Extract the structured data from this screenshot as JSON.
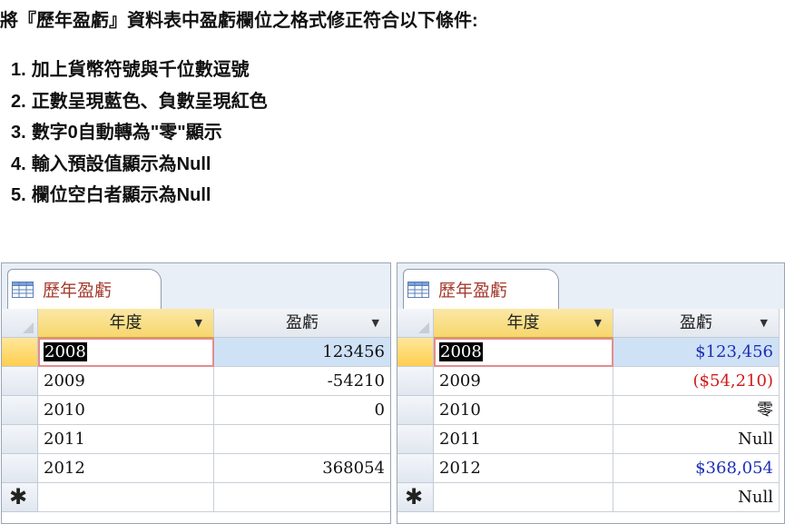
{
  "instructions": {
    "title": "將『歷年盈虧』資料表中盈虧欄位之格式修正符合以下條件:",
    "conditions": [
      {
        "num": "1.",
        "text": "加上貨幣符號與千位數逗號"
      },
      {
        "num": "2.",
        "text": "正數呈現藍色、負數呈現紅色"
      },
      {
        "num": "3.",
        "text": "數字0自動轉為\"零\"顯示"
      },
      {
        "num": "4.",
        "text": "輸入預設值顯示為Null"
      },
      {
        "num": "5.",
        "text": "欄位空白者顯示為Null"
      }
    ]
  },
  "left_table": {
    "tab_label": "歷年盈虧",
    "columns": [
      "年度",
      "盈虧"
    ],
    "rows": [
      {
        "year": "2008",
        "profit": "123456"
      },
      {
        "year": "2009",
        "profit": "-54210"
      },
      {
        "year": "2010",
        "profit": "0"
      },
      {
        "year": "2011",
        "profit": ""
      },
      {
        "year": "2012",
        "profit": "368054"
      }
    ],
    "new_row_marker": "✱",
    "new_row_profit": ""
  },
  "right_table": {
    "tab_label": "歷年盈虧",
    "columns": [
      "年度",
      "盈虧"
    ],
    "rows": [
      {
        "year": "2008",
        "profit": "$123,456"
      },
      {
        "year": "2009",
        "profit": "($54,210)"
      },
      {
        "year": "2010",
        "profit": "零"
      },
      {
        "year": "2011",
        "profit": "Null"
      },
      {
        "year": "2012",
        "profit": "$368,054"
      }
    ],
    "new_row_marker": "✱",
    "new_row_profit": "Null"
  },
  "icons": {
    "table": "table-icon",
    "dropdown": "chevron-down-icon",
    "new_record": "asterisk-icon"
  },
  "colors": {
    "positive": "#1e2fb5",
    "negative": "#d11a1a",
    "header_gold": "#f7d66c",
    "tab_label": "#a53b2f"
  }
}
